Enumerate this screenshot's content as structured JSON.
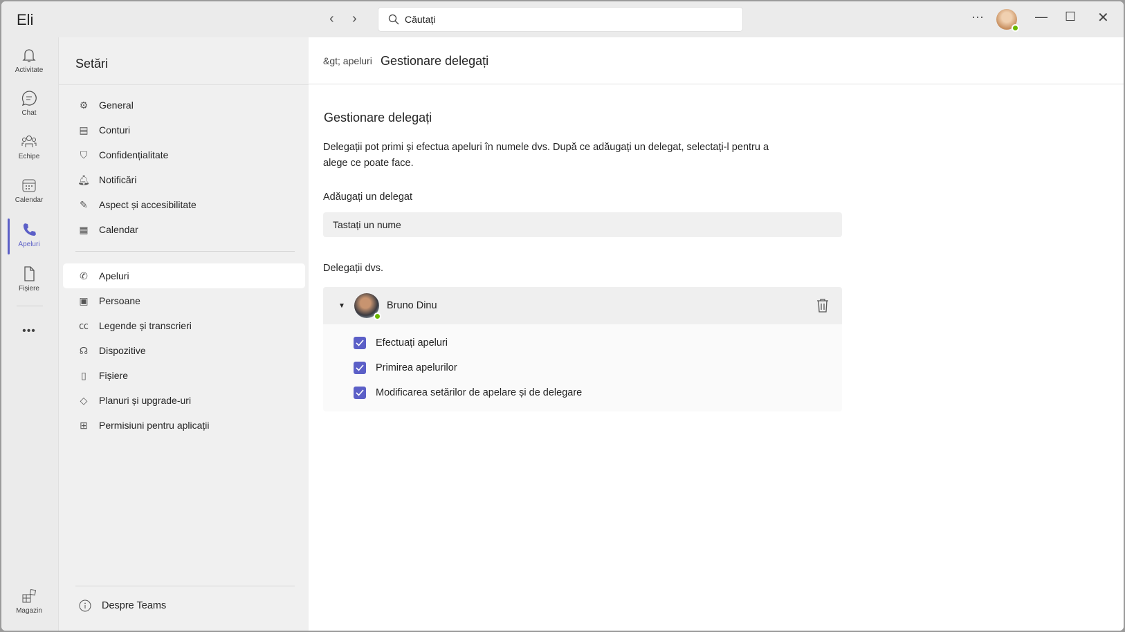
{
  "app": {
    "title": "Eli"
  },
  "search": {
    "placeholder": "Căutați"
  },
  "rail": {
    "items": [
      {
        "label": "Activitate",
        "icon": "bell-icon"
      },
      {
        "label": "Chat",
        "icon": "chat-icon"
      },
      {
        "label": "Echipe",
        "icon": "teams-icon"
      },
      {
        "label": "Calendar",
        "icon": "calendar-icon"
      },
      {
        "label": "Apeluri",
        "icon": "phone-icon",
        "active": true
      },
      {
        "label": "Fișiere",
        "icon": "file-icon"
      },
      {
        "label": "Magazin",
        "icon": "apps-icon"
      }
    ],
    "more": "•••"
  },
  "settings": {
    "title": "Setări",
    "items": [
      {
        "label": "General",
        "icon": "⚙"
      },
      {
        "label": "Conturi",
        "icon": "▤"
      },
      {
        "label": "Confidențialitate",
        "icon": "⛉"
      },
      {
        "label": "Notificări",
        "icon": "🔔︎"
      },
      {
        "label": "Aspect și accesibilitate",
        "icon": "✎"
      },
      {
        "label": "Calendar",
        "icon": "▦"
      },
      {
        "label": "Apeluri",
        "icon": "✆"
      },
      {
        "label": "Persoane",
        "icon": "▣"
      },
      {
        "label": "Legende și transcrieri",
        "icon": "㏄"
      },
      {
        "label": "Dispozitive",
        "icon": "☊"
      },
      {
        "label": "Fișiere",
        "icon": "▯"
      },
      {
        "label": "Planuri și upgrade-uri",
        "icon": "◇"
      },
      {
        "label": "Permisiuni pentru aplicații",
        "icon": "⊞"
      }
    ],
    "about": "Despre Teams"
  },
  "main": {
    "breadcrumb": "&gt; apeluri",
    "header_title": "Gestionare delegați",
    "section_title": "Gestionare delegați",
    "description": "Delegații pot primi și efectua apeluri în numele dvs. După ce adăugați un delegat, selectați-l pentru a alege ce poate face.",
    "add_label": "Adăugați un delegat",
    "add_placeholder": "Tastați un nume",
    "delegates_label": "Delegații dvs.",
    "delegates": [
      {
        "name": "Bruno Dinu",
        "status": "available",
        "permissions": [
          {
            "label": "Efectuați apeluri",
            "checked": true
          },
          {
            "label": "Primirea apelurilor",
            "checked": true
          },
          {
            "label": "Modificarea setărilor de apelare și de delegare",
            "checked": true
          }
        ]
      }
    ]
  },
  "colors": {
    "accent": "#5b5fc7",
    "presence": "#6bb700"
  }
}
